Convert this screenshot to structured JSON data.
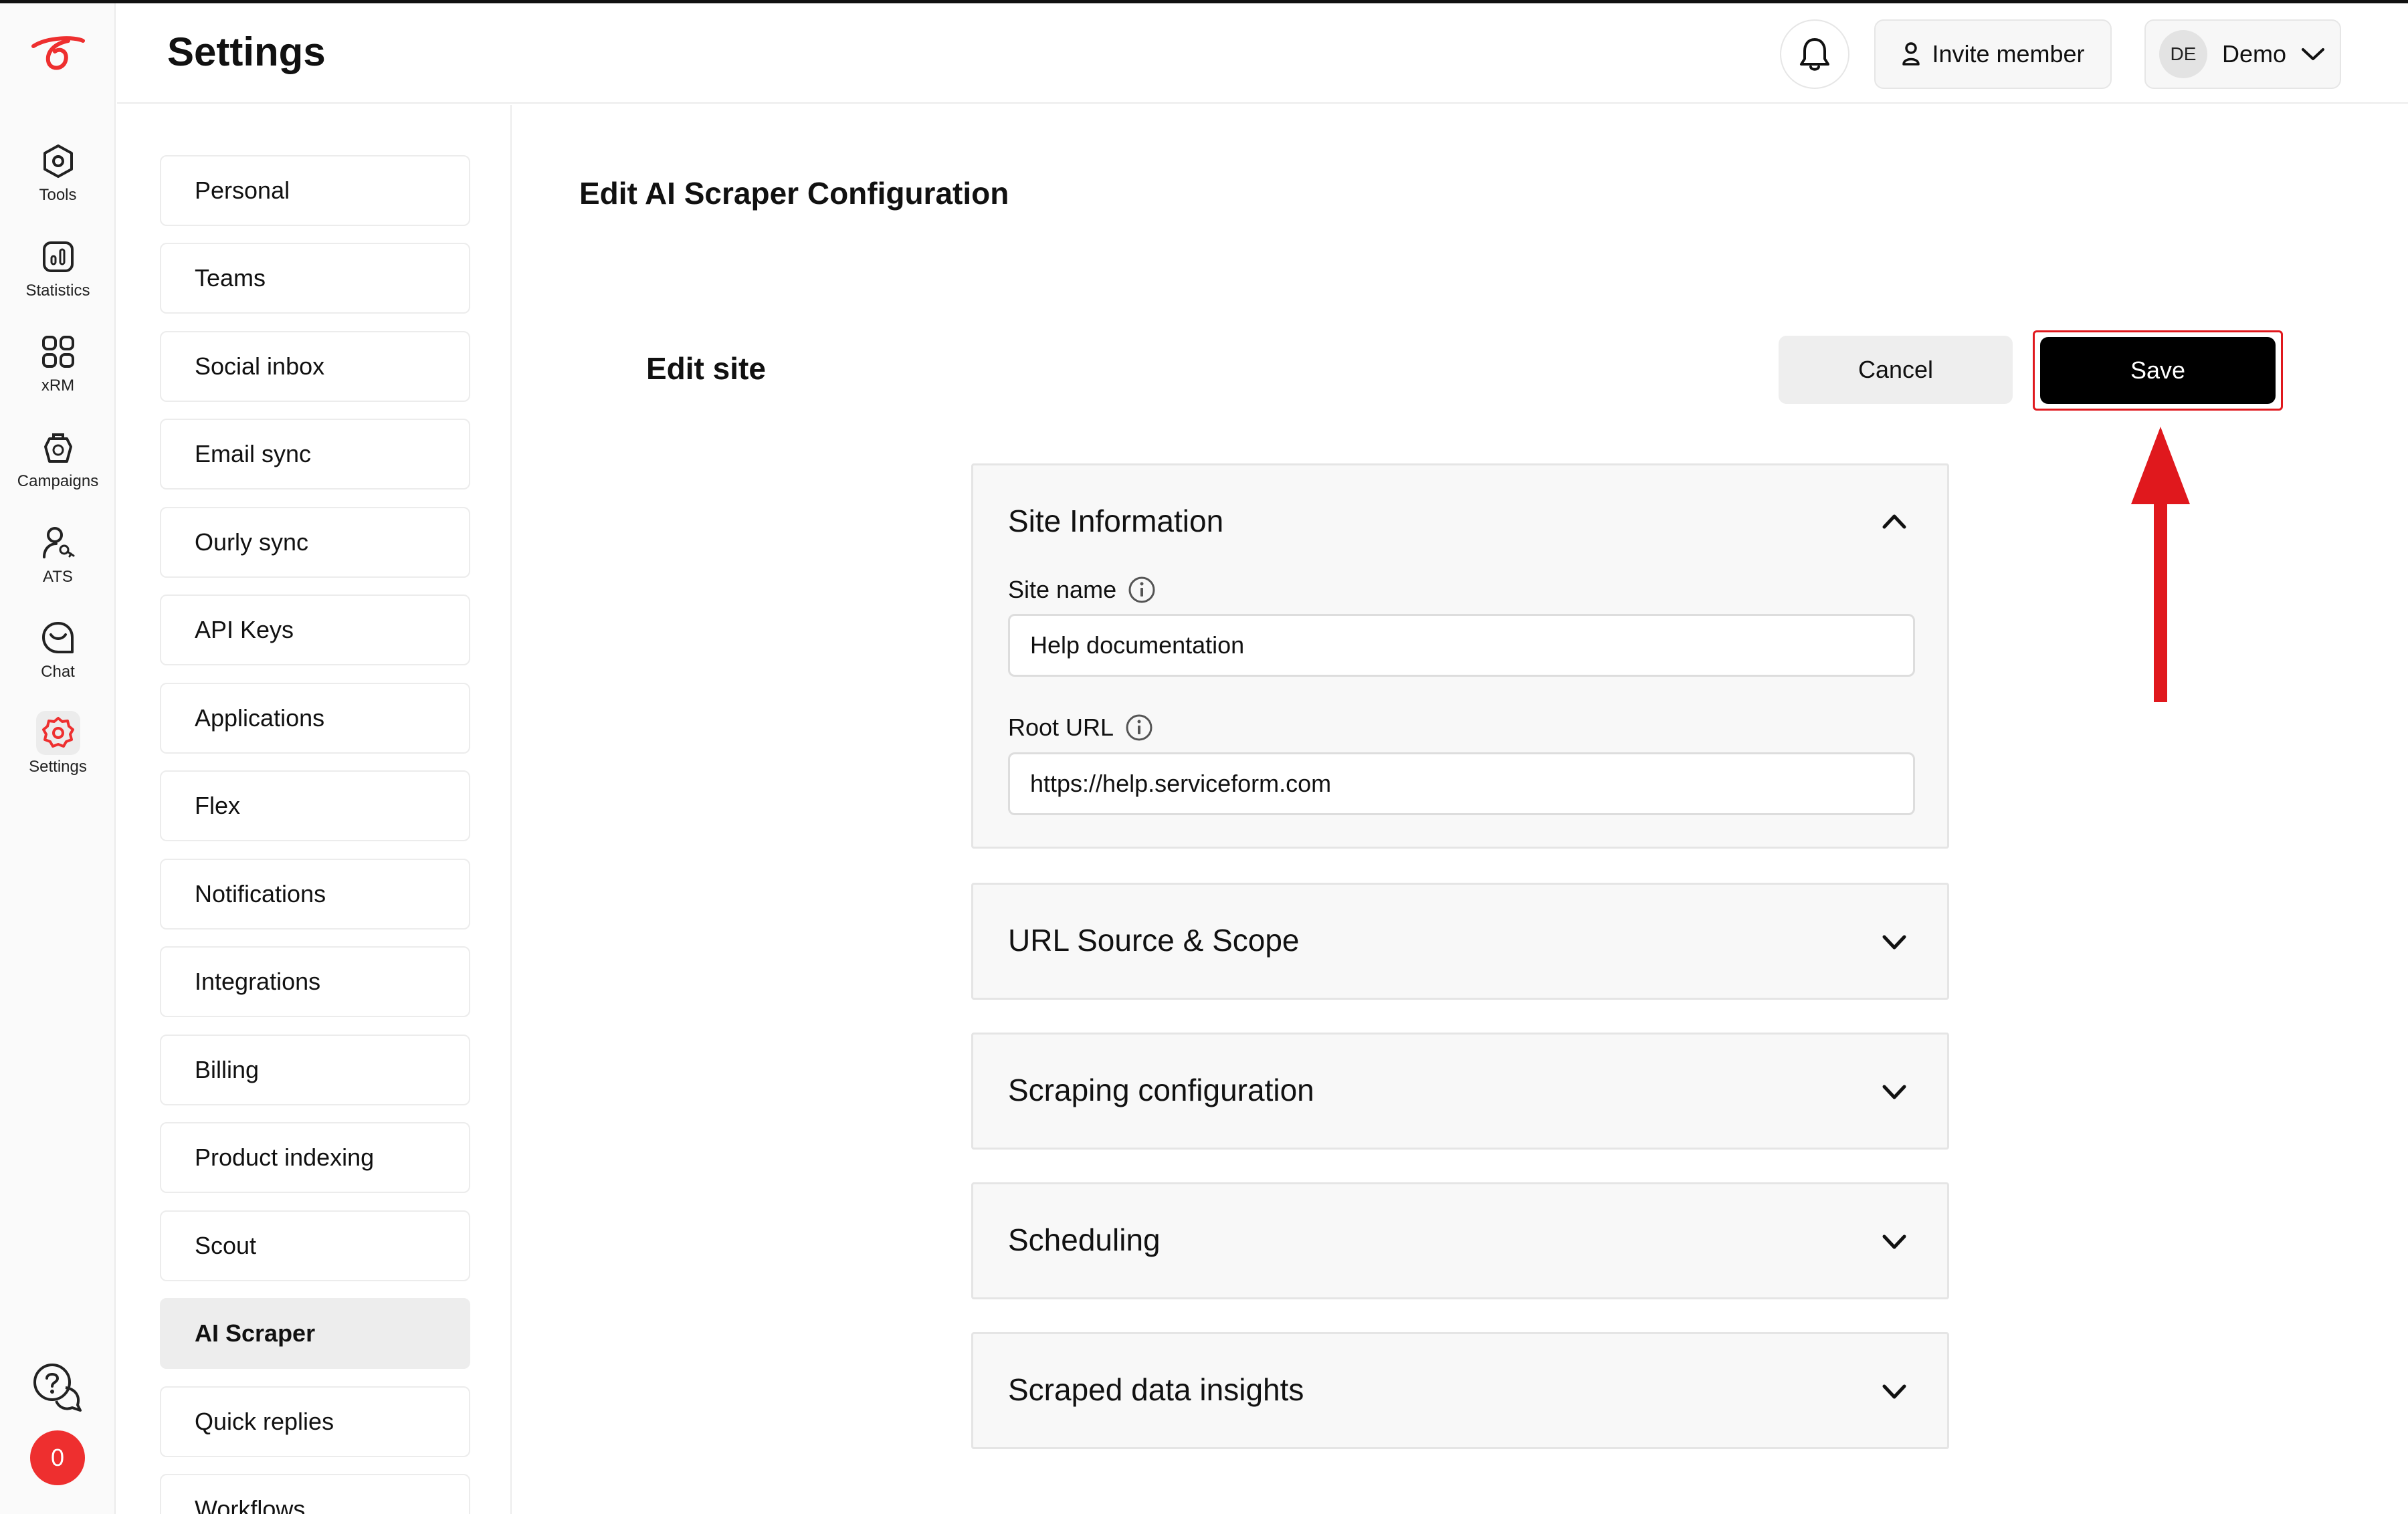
{
  "rail": {
    "items": [
      {
        "label": "Tools",
        "icon": "hexagon-tools-icon"
      },
      {
        "label": "Statistics",
        "icon": "bar-chart-icon"
      },
      {
        "label": "xRM",
        "icon": "grid-icon"
      },
      {
        "label": "Campaigns",
        "icon": "campaign-icon"
      },
      {
        "label": "ATS",
        "icon": "user-key-icon"
      },
      {
        "label": "Chat",
        "icon": "chat-icon"
      },
      {
        "label": "Settings",
        "icon": "gear-icon"
      }
    ],
    "active": "Settings",
    "badge_count": "0",
    "accent_color": "#ee2f2f"
  },
  "header": {
    "title": "Settings",
    "invite_label": "Invite member",
    "user_initials": "DE",
    "user_name": "Demo"
  },
  "settings_nav": {
    "items": [
      {
        "label": "Personal"
      },
      {
        "label": "Teams"
      },
      {
        "label": "Social inbox"
      },
      {
        "label": "Email sync"
      },
      {
        "label": "Ourly sync"
      },
      {
        "label": "API Keys"
      },
      {
        "label": "Applications"
      },
      {
        "label": "Flex"
      },
      {
        "label": "Notifications"
      },
      {
        "label": "Integrations"
      },
      {
        "label": "Billing"
      },
      {
        "label": "Product indexing"
      },
      {
        "label": "Scout"
      },
      {
        "label": "AI Scraper"
      },
      {
        "label": "Quick replies"
      },
      {
        "label": "Workflows"
      }
    ],
    "active": "AI Scraper"
  },
  "main": {
    "title": "Edit AI Scraper Configuration",
    "section_title": "Edit site",
    "cancel_label": "Cancel",
    "save_label": "Save",
    "panels": [
      {
        "title": "Site Information",
        "expanded": true,
        "fields": [
          {
            "label": "Site name",
            "value": "Help documentation"
          },
          {
            "label": "Root URL",
            "value": "https://help.serviceform.com"
          }
        ]
      },
      {
        "title": "URL Source & Scope",
        "expanded": false
      },
      {
        "title": "Scraping configuration",
        "expanded": false
      },
      {
        "title": "Scheduling",
        "expanded": false
      },
      {
        "title": "Scraped data insights",
        "expanded": false
      }
    ]
  },
  "annotation": {
    "color": "#e0181d",
    "target": "Save"
  }
}
